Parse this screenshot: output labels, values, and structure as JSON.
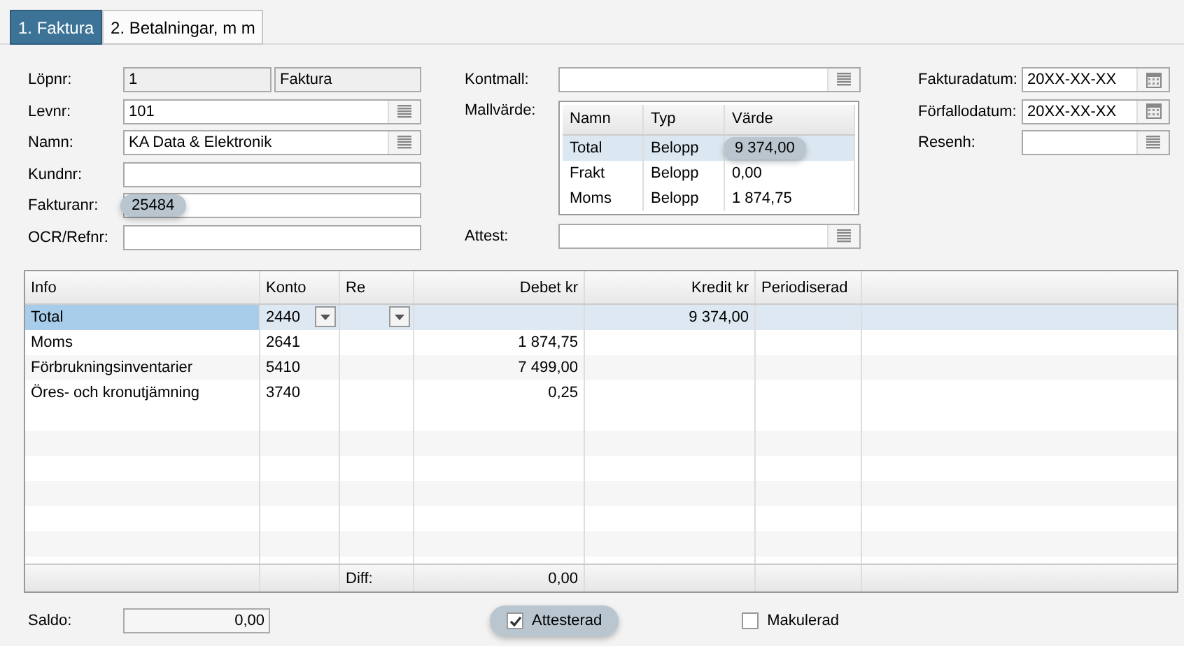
{
  "tabs": [
    {
      "label": "1. Faktura",
      "selected": true
    },
    {
      "label": "2. Betalningar, m m",
      "selected": false
    }
  ],
  "left_fields": [
    {
      "label": "Löpnr:",
      "kind": "readonly",
      "value": "1",
      "extra": "Faktura"
    },
    {
      "label": "Levnr:",
      "kind": "lookup",
      "value": "101"
    },
    {
      "label": "Namn:",
      "kind": "lookup",
      "value": "KA Data & Elektronik"
    },
    {
      "label": "Kundnr:",
      "kind": "text"
    },
    {
      "label": "Fakturanr:",
      "kind": "text",
      "value": "25484",
      "highlighted": true
    },
    {
      "label": "OCR/Refnr:",
      "kind": "text"
    }
  ],
  "kontmall": {
    "label": "Kontmall:",
    "kind": "lookup"
  },
  "mallvarde": {
    "label": "Mallvärde:",
    "columns": [
      "Namn",
      "Typ",
      "Värde"
    ],
    "rows": [
      {
        "cells": [
          "Total",
          "Belopp",
          "9 374,00"
        ],
        "selected": true,
        "highlighted": true
      },
      {
        "cells": [
          "Frakt",
          "Belopp",
          "0,00"
        ],
        "selected": false,
        "highlighted": false
      },
      {
        "cells": [
          "Moms",
          "Belopp",
          "1 874,75"
        ],
        "selected": false,
        "highlighted": false
      }
    ]
  },
  "attest": {
    "label": "Attest:",
    "kind": "lookup"
  },
  "right_fields": [
    {
      "label": "Fakturadatum:",
      "kind": "date",
      "value": "20XX-XX-XX"
    },
    {
      "label": "Förfallodatum:",
      "kind": "date",
      "value": "20XX-XX-XX"
    },
    {
      "label": "Resenh:",
      "kind": "lookup"
    }
  ],
  "table": {
    "columns": [
      "Info",
      "Konto",
      "Re",
      "Debet kr",
      "Kredit kr",
      "Periodiserad"
    ],
    "rows": [
      {
        "cells": [
          "Total",
          "2440",
          "",
          "",
          "9 374,00",
          ""
        ],
        "selected": true
      },
      {
        "cells": [
          "Moms",
          "2641",
          "",
          "1 874,75",
          "",
          ""
        ],
        "selected": false
      },
      {
        "cells": [
          "Förbrukningsinventarier",
          "5410",
          "",
          "7 499,00",
          "",
          ""
        ],
        "selected": false
      },
      {
        "cells": [
          "Öres- och kronutjämning",
          "3740",
          "",
          "0,25",
          "",
          ""
        ],
        "selected": false
      }
    ],
    "footer": {
      "label": "Diff:",
      "value": "0,00"
    }
  },
  "saldo": {
    "label": "Saldo:",
    "value": "0,00"
  },
  "checkboxes": [
    {
      "label": "Attesterad",
      "checked": true,
      "highlighted": true
    },
    {
      "label": "Makulerad",
      "checked": false,
      "highlighted": false
    }
  ]
}
